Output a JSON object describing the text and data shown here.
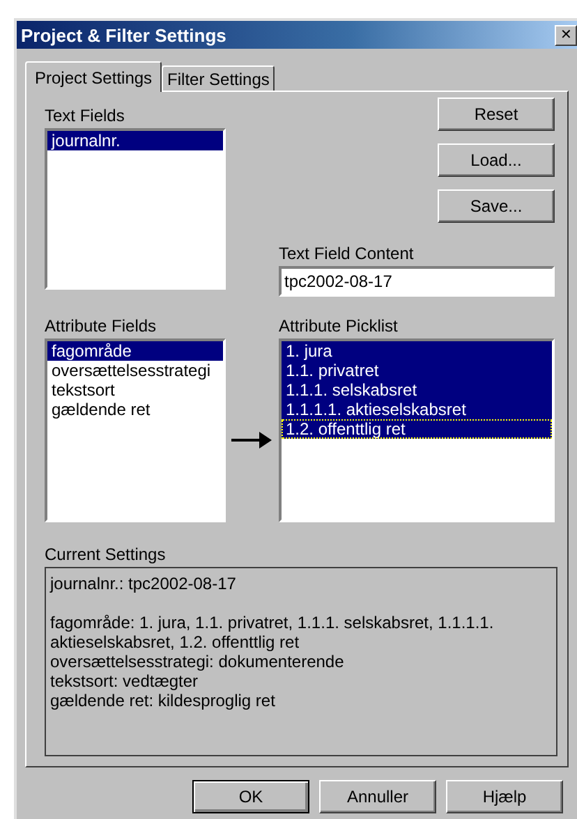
{
  "window": {
    "title": "Project & Filter Settings",
    "close": "✕"
  },
  "tabs": [
    {
      "label": "Project Settings",
      "selected": true
    },
    {
      "label": "Filter Settings",
      "selected": false
    }
  ],
  "text_fields": {
    "label": "Text Fields",
    "items": [
      {
        "label": "journalnr.",
        "selected": true
      }
    ]
  },
  "side_buttons": [
    "Reset",
    "Load...",
    "Save..."
  ],
  "text_field_content": {
    "label": "Text Field Content",
    "value": "tpc2002-08-17"
  },
  "attribute_fields": {
    "label": "Attribute Fields",
    "items": [
      {
        "label": "fagområde",
        "selected": true
      },
      {
        "label": "oversættelsesstrategi",
        "selected": false
      },
      {
        "label": "tekstsort",
        "selected": false
      },
      {
        "label": "gældende ret",
        "selected": false
      }
    ]
  },
  "attribute_picklist": {
    "label": "Attribute Picklist",
    "items": [
      {
        "label": "1. jura",
        "selected": true,
        "focused": false
      },
      {
        "label": "1.1. privatret",
        "selected": true,
        "focused": false
      },
      {
        "label": "1.1.1. selskabsret",
        "selected": true,
        "focused": false
      },
      {
        "label": "1.1.1.1. aktieselskabsret",
        "selected": true,
        "focused": false
      },
      {
        "label": "1.2. offenttlig ret",
        "selected": true,
        "focused": true
      }
    ]
  },
  "current_settings": {
    "label": "Current Settings",
    "groups": [
      [
        "journalnr.: tpc2002-08-17"
      ],
      [
        "fagområde: 1. jura, 1.1. privatret, 1.1.1. selskabsret, 1.1.1.1. aktieselskabsret, 1.2. offenttlig ret",
        "oversættelsesstrategi: dokumenterende",
        "tekstsort: vedtægter",
        "gældende ret: kildesproglig ret"
      ]
    ]
  },
  "buttons": [
    {
      "label": "OK",
      "default": true
    },
    {
      "label": "Annuller",
      "default": false
    },
    {
      "label": "Hjælp",
      "default": false
    }
  ]
}
